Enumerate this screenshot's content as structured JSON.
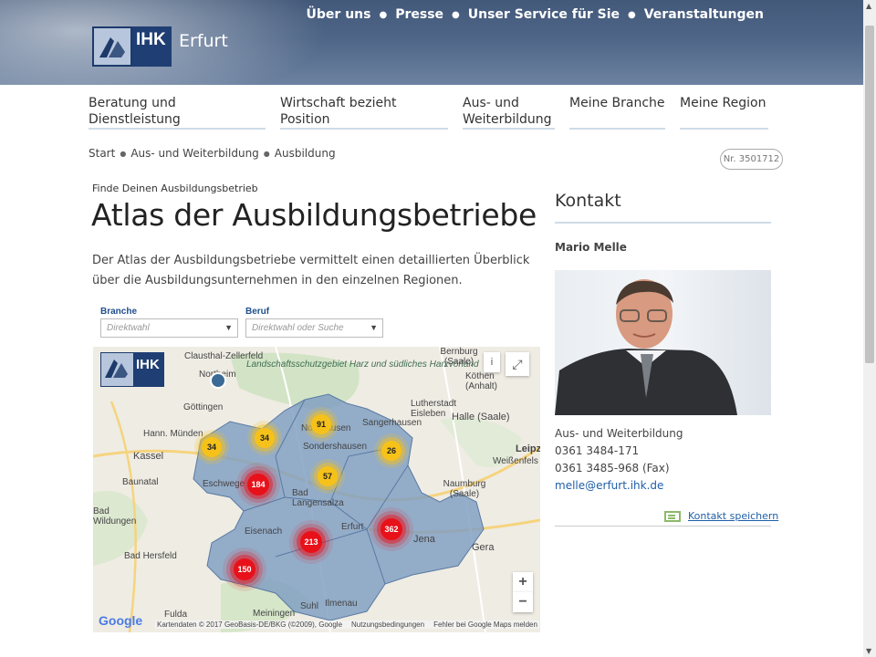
{
  "header": {
    "logo_text": "IHK",
    "brand": "Erfurt",
    "meta_nav": [
      "Über uns",
      "Presse",
      "Unser Service für Sie",
      "Veranstaltungen"
    ]
  },
  "main_nav": [
    {
      "label": "Beratung und Dienstleistung"
    },
    {
      "label": "Wirtschaft bezieht Position"
    },
    {
      "label": "Aus- und Weiterbildung"
    },
    {
      "label": "Meine Branche"
    },
    {
      "label": "Meine Region"
    }
  ],
  "breadcrumb": [
    "Start",
    "Aus- und Weiterbildung",
    "Ausbildung"
  ],
  "doc_nr": "Nr. 3501712",
  "content": {
    "kicker": "Finde Deinen Ausbildungsbetrieb",
    "title": "Atlas der Ausbildungsbetriebe",
    "intro": "Der Atlas der Ausbildungsbetriebe vermittelt einen detaillierten Überblick über die Ausbildungsunternehmen in den einzelnen Regionen."
  },
  "map_widget": {
    "filters": [
      {
        "label": "Branche",
        "placeholder": "Direktwahl"
      },
      {
        "label": "Beruf",
        "placeholder": "Direktwahl oder Suche"
      }
    ],
    "logo_text": "IHK",
    "region_label": "Landschaftsschutzgebiet Harz und südliches Harzvorland",
    "places": {
      "clausthal": "Clausthal-Zellerfeld",
      "northeim": "Northeim",
      "goettingen": "Göttingen",
      "hann_muenden": "Hann. Münden",
      "kassel": "Kassel",
      "baunatal": "Baunatal",
      "bad_wildungen": "Bad Wildungen",
      "bad_hersfeld": "Bad Hersfeld",
      "fulda": "Fulda",
      "eschwege": "Eschwege",
      "nordhausen": "Nordhausen",
      "sondershausen": "Sondershausen",
      "bad_langensalza": "Bad Langensalza",
      "eisenach": "Eisenach",
      "erfurt": "Erfurt",
      "jena": "Jena",
      "gera": "Gera",
      "suhl": "Suhl",
      "ilmenau": "Ilmenau",
      "meiningen": "Meiningen",
      "bernburg": "Bernburg (Saale)",
      "koethen": "Köthen (Anhalt)",
      "lutherstadt": "Lutherstadt Eisleben",
      "sangerhausen": "Sangerhausen",
      "halle": "Halle (Saale)",
      "leipzig": "Leipz",
      "naumburg": "Naumburg (Saale)",
      "weissenfels": "Weißenfels"
    },
    "clusters": [
      {
        "value": "91",
        "level": "medium"
      },
      {
        "value": "34",
        "level": "medium"
      },
      {
        "value": "34",
        "level": "medium"
      },
      {
        "value": "26",
        "level": "medium"
      },
      {
        "value": "57",
        "level": "medium"
      },
      {
        "value": "184",
        "level": "high"
      },
      {
        "value": "213",
        "level": "high"
      },
      {
        "value": "362",
        "level": "high"
      },
      {
        "value": "150",
        "level": "high"
      }
    ],
    "info_btn": "i",
    "zoom_in": "+",
    "zoom_out": "−",
    "google": "Google",
    "attribution": [
      "Kartendaten © 2017 GeoBasis-DE/BKG (©2009), Google",
      "Nutzungsbedingungen",
      "Fehler bei Google Maps melden"
    ]
  },
  "sidebar": {
    "title": "Kontakt",
    "name": "Mario Melle",
    "department": "Aus- und Weiterbildung",
    "phone": "0361 3484-171",
    "fax": "0361 3485-968 (Fax)",
    "email": "melle@erfurt.ihk.de",
    "save_label": "Kontakt speichern"
  },
  "colors": {
    "header_blue": "#4e6587",
    "ihk_blue": "#1f3e73",
    "link_blue": "#1f5fa8",
    "cluster_yellow": "#f6c21a",
    "cluster_red": "#e8111a",
    "region_fill": "#7f9dc2"
  }
}
